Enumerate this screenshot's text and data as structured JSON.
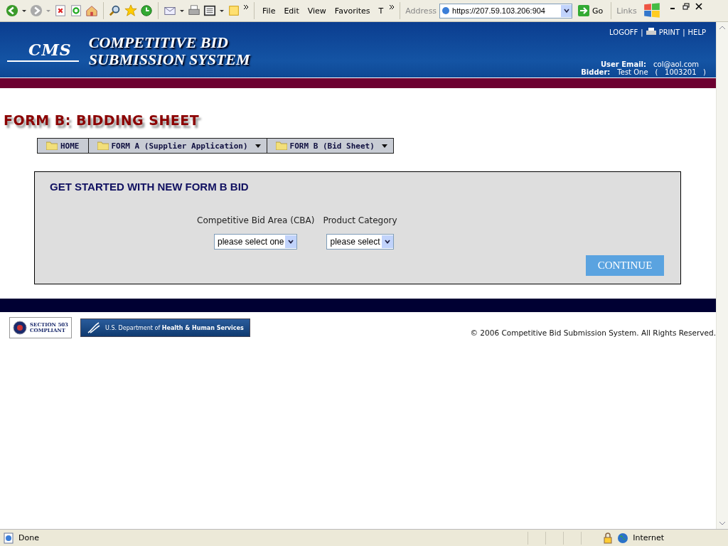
{
  "browser": {
    "menu": [
      {
        "label": "File"
      },
      {
        "label": "Edit"
      },
      {
        "label": "View"
      },
      {
        "label": "Favorites"
      },
      {
        "label": "T"
      }
    ],
    "address_label": "Address",
    "address": "https://207.59.103.206:904",
    "go": "Go",
    "links": "Links"
  },
  "header": {
    "logo": "CMS",
    "title_lines": [
      "COMPETITIVE BID",
      "SUBMISSION SYSTEM"
    ],
    "links": [
      {
        "label": "LOGOFF",
        "kind": "text"
      },
      {
        "separator": "|",
        "label": "PRINT",
        "kind": "print"
      },
      {
        "separator": "|",
        "label": "HELP",
        "kind": "text"
      }
    ],
    "user_email_label": "User Email:",
    "user_email": "col@aol.com",
    "bidder_label": "Bidder:",
    "bidder": "Test One",
    "bidder_id": "(   1003201   )"
  },
  "page_title": "FORM B:  BIDDING SHEET",
  "nav": [
    {
      "label": "HOME",
      "dropdown": false
    },
    {
      "label": "FORM A (Supplier Application)",
      "dropdown": true
    },
    {
      "label": "FORM B (Bid Sheet)",
      "dropdown": true
    }
  ],
  "panel": {
    "heading": "GET STARTED WITH NEW FORM B BID",
    "fields": [
      {
        "label": "Competitive Bid Area (CBA)",
        "value": "please select one"
      },
      {
        "label": "Product Category",
        "value": "please select"
      }
    ],
    "button": "CONTINUE"
  },
  "footer": {
    "badge": [
      "SECTION 503",
      "COMPLIANT"
    ],
    "hhs": "U.S. Department of **Health & Human Services**",
    "copyright": "© 2006 Competitive Bid Submission System. All Rights Reserved."
  },
  "status_bar": {
    "text": "Done",
    "zone": "Internet"
  }
}
